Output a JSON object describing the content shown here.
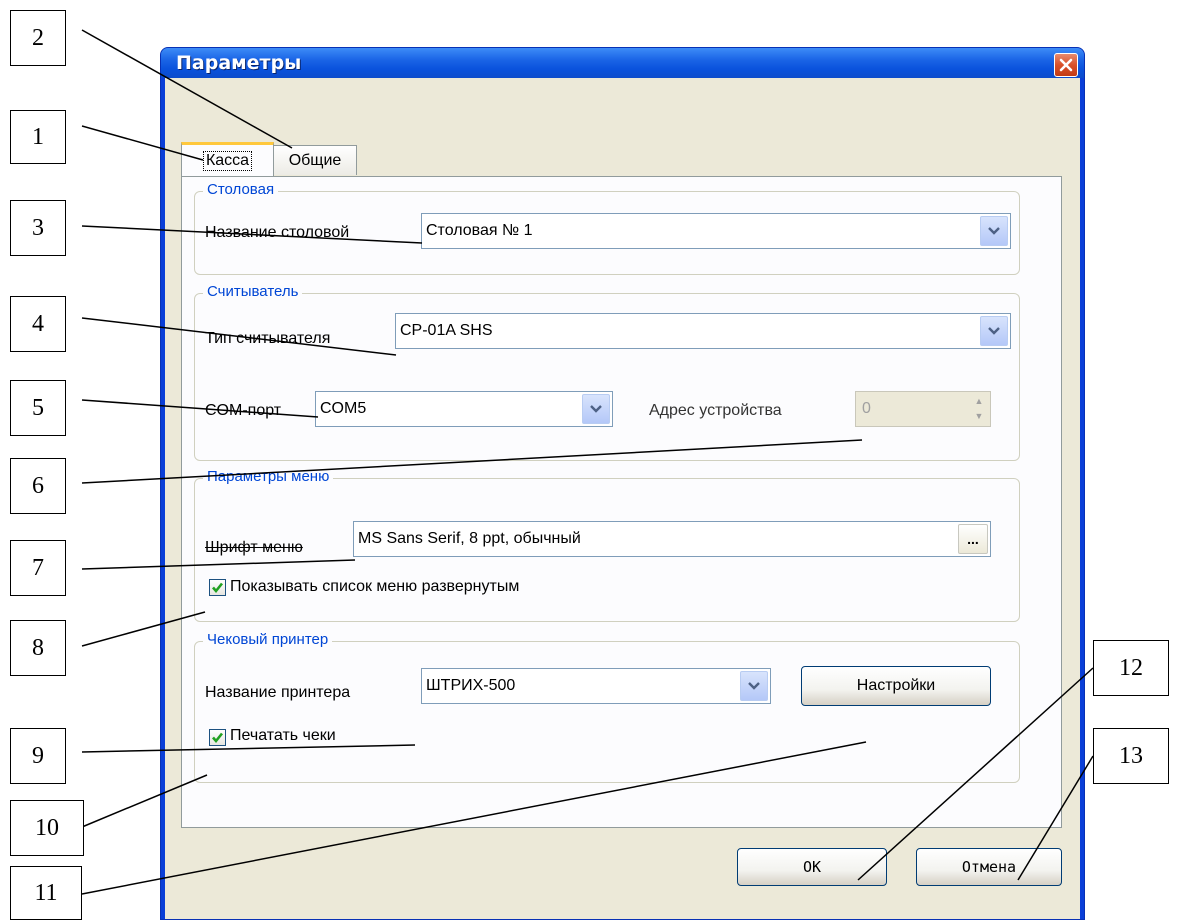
{
  "window": {
    "title": "Параметры"
  },
  "tabs": [
    {
      "label": "Касса"
    },
    {
      "label": "Общие"
    }
  ],
  "canteen_group": {
    "title": "Столовая",
    "name_label": "Название столовой",
    "name_value": "Столовая № 1"
  },
  "reader_group": {
    "title": "Считыватель",
    "type_label": "Тип считывателя",
    "type_value": "CP-01A SHS",
    "com_label": "COM-порт",
    "com_value": "COM5",
    "address_label": "Адрес устройства",
    "address_value": "0"
  },
  "menu_group": {
    "title": "Параметры меню",
    "font_label": "Шрифт меню",
    "font_value": "MS Sans Serif, 8 ppt, обычный",
    "ellipsis": "...",
    "expand_checkbox_label": "Показывать список меню развернутым",
    "expand_checked": true
  },
  "printer_group": {
    "title": "Чековый принтер",
    "name_label": "Название принтера",
    "name_value": "ШТРИХ-500",
    "settings_button": "Настройки",
    "print_checkbox_label": "Печатать чеки",
    "print_checked": true
  },
  "footer": {
    "ok_button": "OK",
    "cancel_button": "Отмена"
  },
  "callouts": [
    "1",
    "2",
    "3",
    "4",
    "5",
    "6",
    "7",
    "8",
    "9",
    "10",
    "11",
    "12",
    "13"
  ],
  "colors": {
    "titlebar": "#0a52dd",
    "dialog_bg": "#ece9d8",
    "group_title": "#0046d5",
    "close_button": "#d9512a",
    "check_mark": "#21a121"
  }
}
